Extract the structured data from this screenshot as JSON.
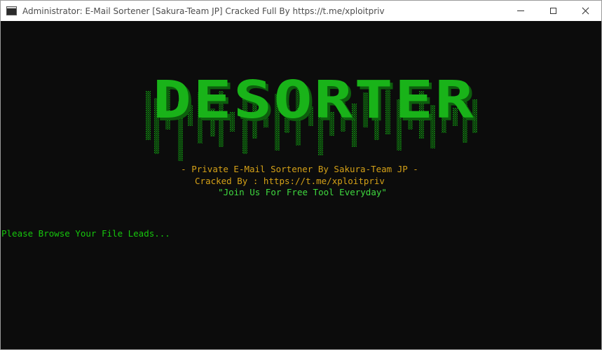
{
  "window": {
    "title": "Administrator:  E-Mail Sortener [Sakura-Team JP] Cracked Full By https://t.me/xploitpriv"
  },
  "console": {
    "banner_text": "DESORTER",
    "info_lines": [
      "- Private E-Mail Sortener By Sakura-Team JP -",
      "Cracked By : https://t.me/xploitpriv",
      "\"Join Us For Free Tool Everyday\""
    ],
    "prompt": "Please Browse Your File Leads..."
  },
  "colors": {
    "console_bg": "#0c0c0c",
    "banner_green": "#19b319",
    "banner_shadow": "#0d5e0d",
    "info_amber": "#d4a017",
    "info_green": "#3fd93f",
    "prompt_green": "#16c60c"
  },
  "icons": {
    "app": "console-app-icon",
    "minimize": "minimize-icon",
    "maximize": "maximize-icon",
    "close": "close-icon"
  }
}
